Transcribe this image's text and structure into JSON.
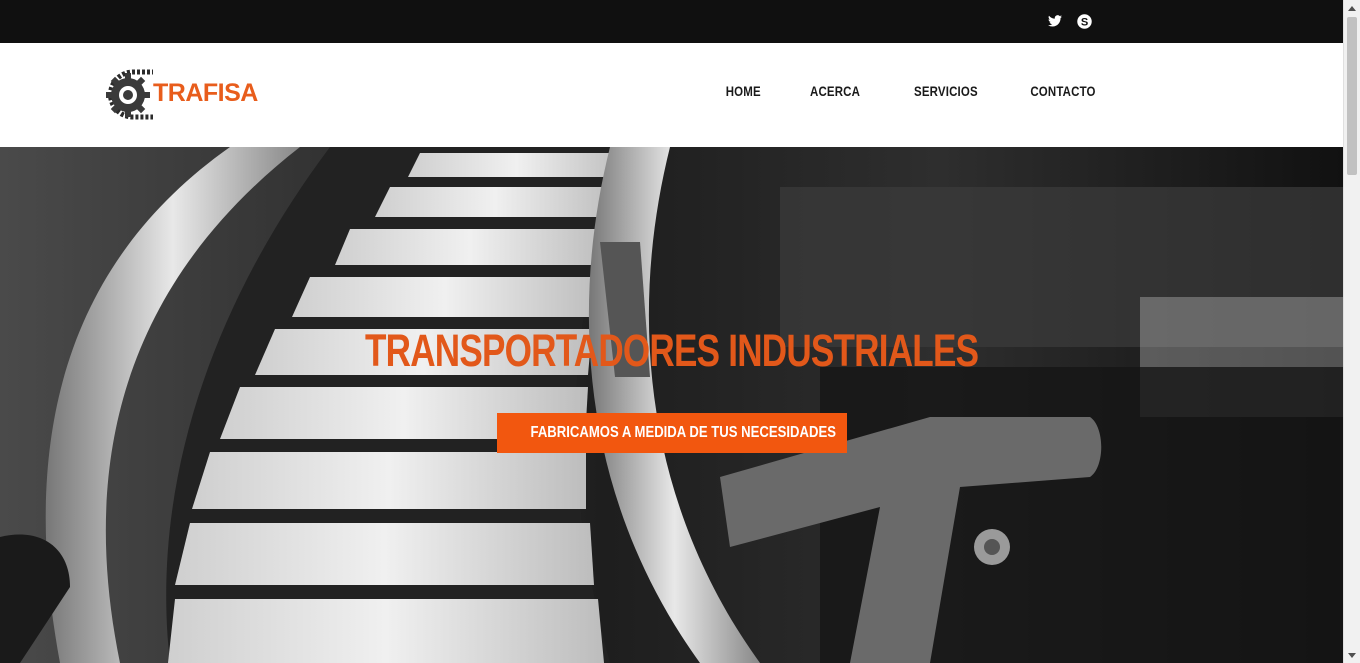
{
  "topbar": {
    "social": [
      {
        "icon": "twitter-icon"
      },
      {
        "icon": "skype-icon"
      }
    ]
  },
  "header": {
    "logo_text": "TRAFISA",
    "nav": [
      "HOME",
      "ACERCA",
      "SERVICIOS",
      "CONTACTO"
    ]
  },
  "hero": {
    "title": "TRANSPORTADORES INDUSTRIALES",
    "button_label": "FABRICAMOS A MEDIDA DE TUS NECESIDADES"
  },
  "colors": {
    "accent": "#f2570f",
    "title": "#e2581a",
    "topbar": "#101010"
  }
}
